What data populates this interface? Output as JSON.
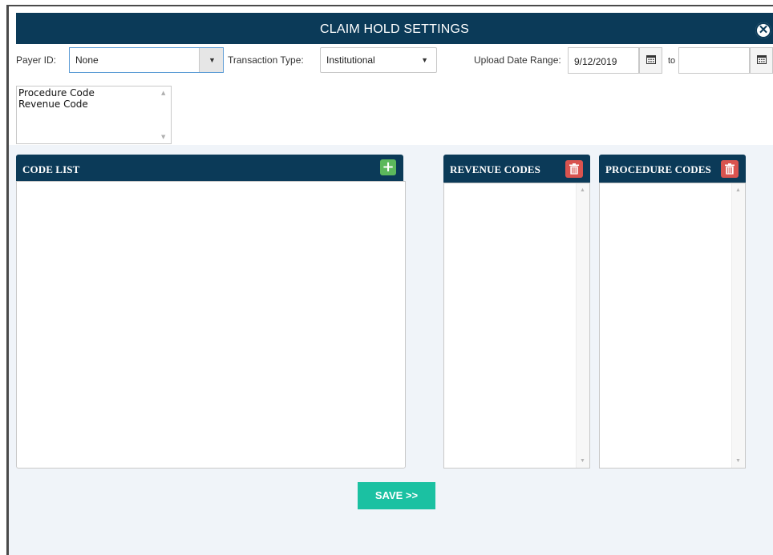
{
  "dialog": {
    "title": "CLAIM HOLD SETTINGS",
    "close_icon": "close-circle-icon"
  },
  "filters": {
    "payer_label": "Payer ID:",
    "payer_value": "None",
    "transaction_label": "Transaction Type:",
    "transaction_value": "Institutional",
    "date_range_label": "Upload Date Range:",
    "date_from": "9/12/2019",
    "date_to_label": "to",
    "date_to": ""
  },
  "code_types": {
    "options": [
      "Procedure Code",
      "Revenue Code"
    ]
  },
  "panels": {
    "code_list": {
      "title": "CODE LIST",
      "action_icon": "plus-icon"
    },
    "revenue_codes": {
      "title": "REVENUE CODES",
      "action_icon": "trash-icon"
    },
    "procedure_codes": {
      "title": "PROCEDURE CODES",
      "action_icon": "trash-icon"
    }
  },
  "footer": {
    "save_label": "SAVE >>"
  },
  "colors": {
    "header_bg": "#0b3a58",
    "save_bg": "#1bc1a2",
    "add_bg": "#5cb85c",
    "delete_bg": "#d9534f",
    "content_bg": "#f0f4f9"
  }
}
